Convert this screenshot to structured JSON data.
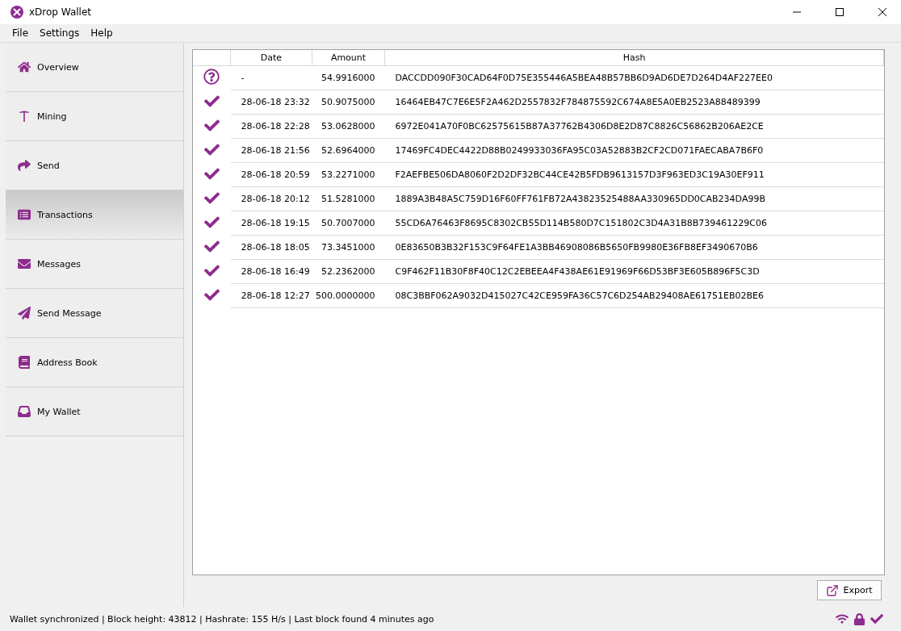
{
  "window": {
    "title": "xDrop Wallet"
  },
  "menu": [
    "File",
    "Settings",
    "Help"
  ],
  "sidebar": {
    "items": [
      {
        "label": "Overview",
        "selected": false
      },
      {
        "label": "Mining",
        "selected": false
      },
      {
        "label": "Send",
        "selected": false
      },
      {
        "label": "Transactions",
        "selected": true
      },
      {
        "label": "Messages",
        "selected": false
      },
      {
        "label": "Send Message",
        "selected": false
      },
      {
        "label": "Address Book",
        "selected": false
      },
      {
        "label": "My Wallet",
        "selected": false
      }
    ]
  },
  "table": {
    "columns": [
      "Date",
      "Amount",
      "Hash"
    ],
    "rows": [
      {
        "kind": "pending",
        "date": "-",
        "amount": "54.9916000",
        "hash": "DACCDD090F30CAD64F0D75E355446A5BEA48B57BB6D9AD6DE7D264D4AF227EE0"
      },
      {
        "kind": "confirmed",
        "date": "28-06-18 23:32",
        "amount": "50.9075000",
        "hash": "16464EB47C7E6E5F2A462D2557832F784875592C674A8E5A0EB2523A88489399"
      },
      {
        "kind": "confirmed",
        "date": "28-06-18 22:28",
        "amount": "53.0628000",
        "hash": "6972E041A70F0BC62575615B87A37762B4306D8E2D87C8826C56862B206AE2CE"
      },
      {
        "kind": "confirmed",
        "date": "28-06-18 21:56",
        "amount": "52.6964000",
        "hash": "17469FC4DEC4422D88B0249933036FA95C03A52883B2CF2CD071FAECABA7B6F0"
      },
      {
        "kind": "confirmed",
        "date": "28-06-18 20:59",
        "amount": "53.2271000",
        "hash": "F2AEFBE506DA8060F2D2DF32BC44CE42B5FDB9613157D3F963ED3C19A30EF911"
      },
      {
        "kind": "confirmed",
        "date": "28-06-18 20:12",
        "amount": "51.5281000",
        "hash": "1889A3B48A5C759D16F60FF761FB72A43823525488AA330965DD0CAB234DA99B"
      },
      {
        "kind": "confirmed",
        "date": "28-06-18 19:15",
        "amount": "50.7007000",
        "hash": "55CD6A76463F8695C8302CB55D114B580D7C151802C3D4A31B8B739461229C06"
      },
      {
        "kind": "confirmed",
        "date": "28-06-18 18:05",
        "amount": "73.3451000",
        "hash": "0E83650B3B32F153C9F64FE1A3BB46908086B5650FB9980E36FB8EF3490670B6"
      },
      {
        "kind": "confirmed",
        "date": "28-06-18 16:49",
        "amount": "52.2362000",
        "hash": "C9F462F11B30F8F40C12C2EBEEA4F438AE61E91969F66D53BF3E605B896F5C3D"
      },
      {
        "kind": "confirmed",
        "date": "28-06-18 12:27",
        "amount": "500.0000000",
        "hash": "08C3BBF062A9032D415027C42CE959FA36C57C6D254AB29408AE61751EB02BE6"
      }
    ]
  },
  "export_button": "Export",
  "status_bar": {
    "text": "Wallet synchronized | Block height: 43812 | Hashrate: 155 H/s | Last block found 4 minutes ago"
  }
}
